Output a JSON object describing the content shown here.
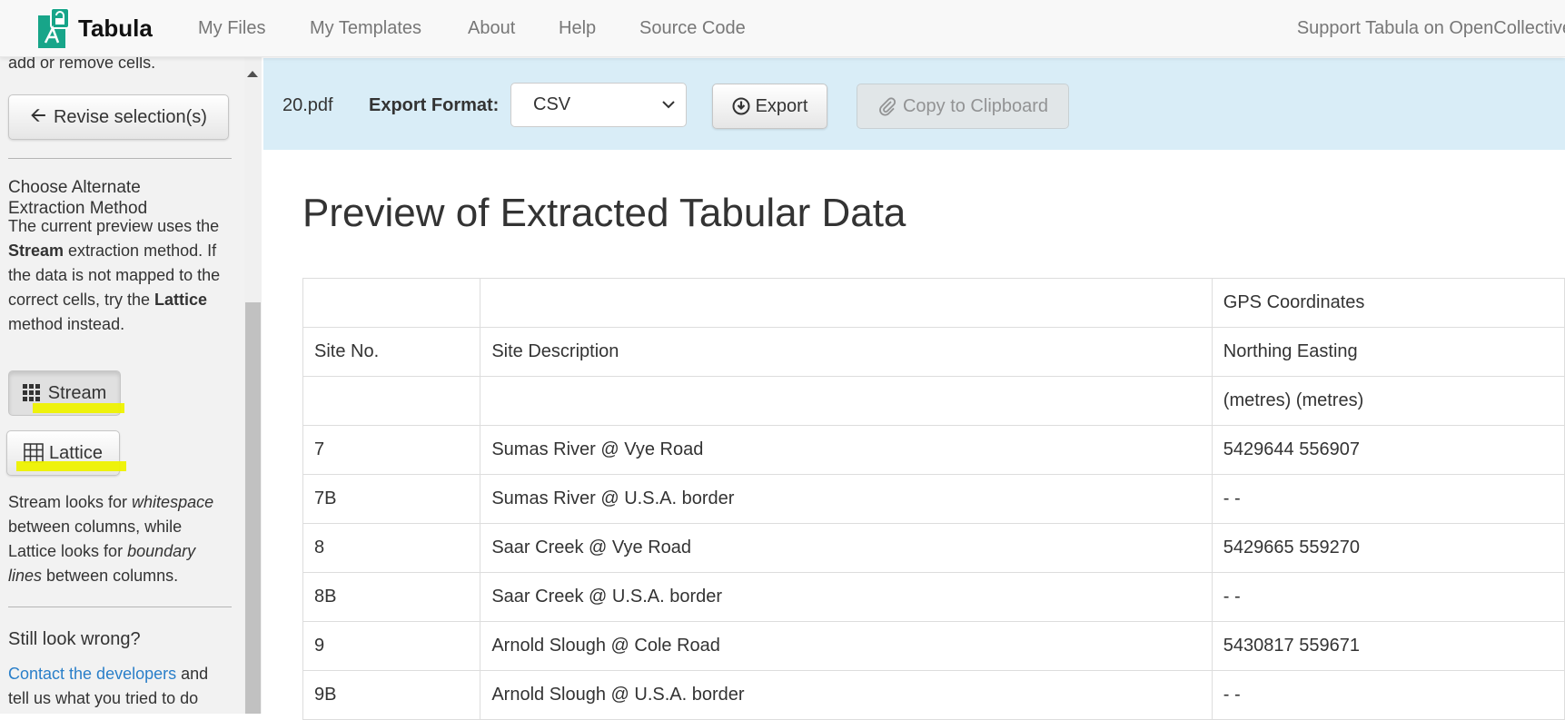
{
  "navbar": {
    "brand": "Tabula",
    "links": [
      "My Files",
      "My Templates",
      "About",
      "Help",
      "Source Code"
    ],
    "right_link": "Support Tabula on OpenCollective"
  },
  "sidebar": {
    "partial_text": "add or remove cells.",
    "revise_button": "Revise selection(s)",
    "alt_heading_1": "Choose Alternate",
    "alt_heading_2": "Extraction Method",
    "desc": {
      "l1": "The current preview uses the",
      "l2_bold": "Stream",
      "l2_rest": " extraction method. If",
      "l3": "the data is not mapped to the",
      "l4_pre": "correct cells, try the ",
      "l4_bold": "Lattice",
      "l5": "method instead."
    },
    "stream_button": "Stream",
    "lattice_button": "Lattice",
    "explain": {
      "l1_pre": "Stream looks for ",
      "l1_em": "whitespace",
      "l2": "between columns, while",
      "l3_pre": "Lattice looks for ",
      "l3_em": "boundary",
      "l4_em": "lines",
      "l4_rest": " between columns."
    },
    "still_wrong": "Still look wrong?",
    "contact_link": "Contact the developers",
    "contact_rest": " and",
    "contact_l2": "tell us what you tried to do"
  },
  "toolbar": {
    "filename": "20.pdf",
    "format_label": "Export Format:",
    "format_value": "CSV",
    "export_button": "Export",
    "copy_button": "Copy to Clipboard"
  },
  "main": {
    "title": "Preview of Extracted Tabular Data",
    "rows": [
      [
        "",
        "",
        "GPS Coordinates"
      ],
      [
        "Site No.",
        "Site Description",
        "Northing Easting"
      ],
      [
        "",
        "",
        "(metres) (metres)"
      ],
      [
        "7",
        "Sumas River @ Vye Road",
        "5429644 556907"
      ],
      [
        "7B",
        "Sumas River @ U.S.A. border",
        "- -"
      ],
      [
        "8",
        "Saar Creek @ Vye Road",
        "5429665 559270"
      ],
      [
        "8B",
        "Saar Creek @ U.S.A. border",
        "- -"
      ],
      [
        "9",
        "Arnold Slough @ Cole Road",
        "5430817 559671"
      ],
      [
        "9B",
        "Arnold Slough @ U.S.A. border",
        "- -"
      ]
    ]
  },
  "colors": {
    "toolbar_bg": "#d9edf7",
    "highlight": "#eef200",
    "link": "#2a7fc9",
    "brand_green": "#17a589"
  }
}
